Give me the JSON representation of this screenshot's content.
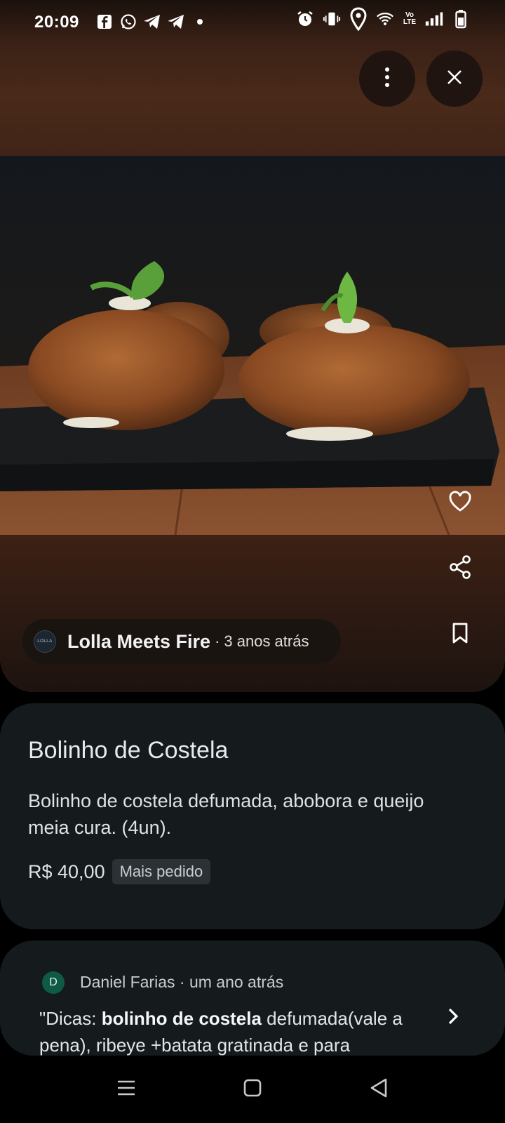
{
  "status_bar": {
    "time": "20:09",
    "left_icons": [
      "facebook-icon",
      "whatsapp-icon",
      "telegram-icon",
      "telegram-icon",
      "dot-icon"
    ],
    "right_icons": [
      "alarm-icon",
      "vibrate-icon",
      "location-icon",
      "wifi-icon",
      "volte-icon",
      "signal-icon",
      "battery-icon"
    ],
    "volte_label": "Vo LTE"
  },
  "actions": {
    "more_icon": "more-vert-icon",
    "close_icon": "close-icon",
    "favorite_icon": "heart-icon",
    "share_icon": "share-icon",
    "bookmark_icon": "bookmark-icon"
  },
  "source": {
    "logo_text": "LOLLA",
    "name": "Lolla Meets Fire",
    "separator": "·",
    "time_ago": "3 anos atrás"
  },
  "dish": {
    "title": "Bolinho de Costela",
    "description": "Bolinho de costela defumada, abobora e queijo meia cura. (4un).",
    "price": "R$ 40,00",
    "badge": "Mais pedido"
  },
  "review": {
    "avatar_letter": "D",
    "author": "Daniel Farias",
    "separator": "·",
    "time_ago": "um ano atrás",
    "text_prefix": "\"Dicas: ",
    "text_bold": "bolinho de costela",
    "text_rest": " defumada(vale a pena), ribeye +batata gratinada e para"
  },
  "colors": {
    "card_bg": "#151a1c",
    "hero_brown": "#3f2417",
    "avatar_green": "#0f5a45"
  },
  "nav": {
    "icons": [
      "recents-icon",
      "home-icon",
      "back-icon"
    ]
  }
}
